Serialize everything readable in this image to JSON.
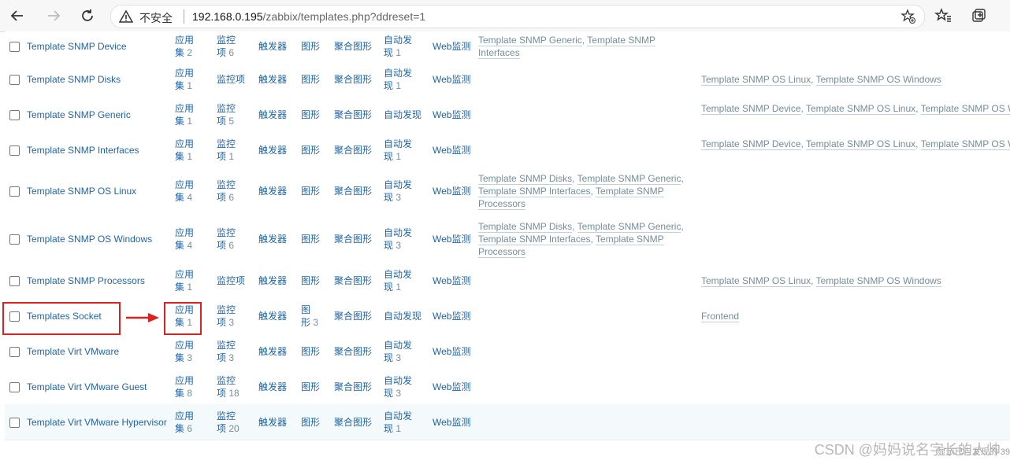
{
  "browser": {
    "insecure_label": "不安全",
    "url_host": "192.168.0.195",
    "url_path": "/zabbix/templates.php?ddreset=1"
  },
  "rows": [
    {
      "name": "Template SNMP Device",
      "apps": "应用集",
      "apps_count": "2",
      "items": "监控项",
      "items_count": "6",
      "triggers": "触发器",
      "graphs": "图形",
      "graphs_count": "",
      "screens": "聚合图形",
      "discovery": "自动发现",
      "discovery_count": "1",
      "web": "Web监测",
      "linked": [
        "Template SNMP Generic",
        "Template SNMP Interfaces"
      ],
      "linked_to": []
    },
    {
      "name": "Template SNMP Disks",
      "apps": "应用集",
      "apps_count": "1",
      "items": "监控项",
      "items_count": "",
      "triggers": "触发器",
      "graphs": "图形",
      "graphs_count": "",
      "screens": "聚合图形",
      "discovery": "自动发现",
      "discovery_count": "1",
      "web": "Web监测",
      "linked": [],
      "linked_to": [
        "Template SNMP OS Linux",
        "Template SNMP OS Windows"
      ]
    },
    {
      "name": "Template SNMP Generic",
      "apps": "应用集",
      "apps_count": "1",
      "items": "监控项",
      "items_count": "5",
      "triggers": "触发器",
      "graphs": "图形",
      "graphs_count": "",
      "screens": "聚合图形",
      "discovery": "自动发现",
      "discovery_count": "",
      "web": "Web监测",
      "linked": [],
      "linked_to": [
        "Template SNMP Device",
        "Template SNMP OS Linux",
        "Template SNMP OS W"
      ]
    },
    {
      "name": "Template SNMP Interfaces",
      "apps": "应用集",
      "apps_count": "1",
      "items": "监控项",
      "items_count": "1",
      "triggers": "触发器",
      "graphs": "图形",
      "graphs_count": "",
      "screens": "聚合图形",
      "discovery": "自动发现",
      "discovery_count": "1",
      "web": "Web监测",
      "linked": [],
      "linked_to": [
        "Template SNMP Device",
        "Template SNMP OS Linux",
        "Template SNMP OS W"
      ]
    },
    {
      "name": "Template SNMP OS Linux",
      "apps": "应用集",
      "apps_count": "4",
      "items": "监控项",
      "items_count": "6",
      "triggers": "触发器",
      "graphs": "图形",
      "graphs_count": "",
      "screens": "聚合图形",
      "discovery": "自动发现",
      "discovery_count": "3",
      "web": "Web监测",
      "linked": [
        "Template SNMP Disks",
        "Template SNMP Generic",
        "Template SNMP Interfaces",
        "Template SNMP Processors"
      ],
      "linked_to": []
    },
    {
      "name": "Template SNMP OS Windows",
      "apps": "应用集",
      "apps_count": "4",
      "items": "监控项",
      "items_count": "6",
      "triggers": "触发器",
      "graphs": "图形",
      "graphs_count": "",
      "screens": "聚合图形",
      "discovery": "自动发现",
      "discovery_count": "3",
      "web": "Web监测",
      "linked": [
        "Template SNMP Disks",
        "Template SNMP Generic",
        "Template SNMP Interfaces",
        "Template SNMP Processors"
      ],
      "linked_to": []
    },
    {
      "name": "Template SNMP Processors",
      "apps": "应用集",
      "apps_count": "1",
      "items": "监控项",
      "items_count": "",
      "triggers": "触发器",
      "graphs": "图形",
      "graphs_count": "",
      "screens": "聚合图形",
      "discovery": "自动发现",
      "discovery_count": "1",
      "web": "Web监测",
      "linked": [],
      "linked_to": [
        "Template SNMP OS Linux",
        "Template SNMP OS Windows"
      ]
    },
    {
      "name": "Templates Socket",
      "apps": "应用集",
      "apps_count": "1",
      "items": "监控项",
      "items_count": "3",
      "triggers": "触发器",
      "graphs": "图形",
      "graphs_count": "3",
      "screens": "聚合图形",
      "discovery": "自动发现",
      "discovery_count": "",
      "web": "Web监测",
      "linked": [],
      "linked_to": [
        "Frontend"
      ]
    },
    {
      "name": "Template Virt VMware",
      "apps": "应用集",
      "apps_count": "3",
      "items": "监控项",
      "items_count": "3",
      "triggers": "触发器",
      "graphs": "图形",
      "graphs_count": "",
      "screens": "聚合图形",
      "discovery": "自动发现",
      "discovery_count": "3",
      "web": "Web监测",
      "linked": [],
      "linked_to": []
    },
    {
      "name": "Template Virt VMware Guest",
      "apps": "应用集",
      "apps_count": "8",
      "items": "监控项",
      "items_count": "18",
      "triggers": "触发器",
      "graphs": "图形",
      "graphs_count": "",
      "screens": "聚合图形",
      "discovery": "自动发现",
      "discovery_count": "3",
      "web": "Web监测",
      "linked": [],
      "linked_to": []
    },
    {
      "name": "Template Virt VMware Hypervisor",
      "apps": "应用集",
      "apps_count": "6",
      "items": "监控项",
      "items_count": "20",
      "triggers": "触发器",
      "graphs": "图形",
      "graphs_count": "",
      "screens": "聚合图形",
      "discovery": "自动发现",
      "discovery_count": "1",
      "web": "Web监测",
      "linked": [],
      "linked_to": []
    }
  ],
  "watermark": "CSDN @妈妈说名字长的人帅",
  "watermark_small": "显示已自发现的 39"
}
